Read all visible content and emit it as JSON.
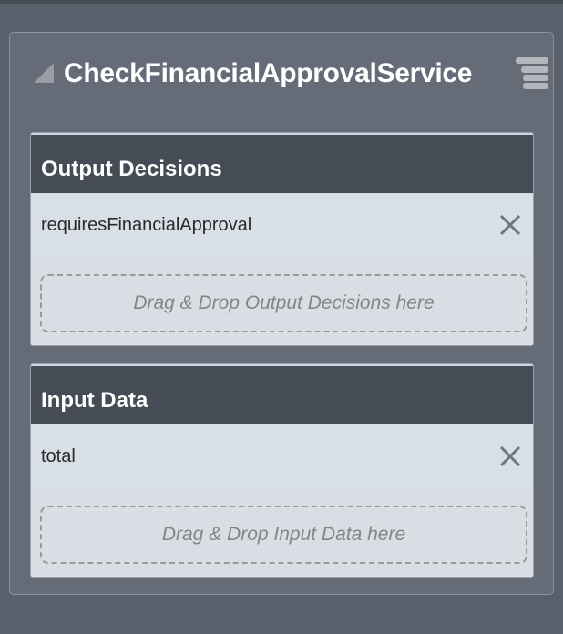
{
  "service": {
    "title": "CheckFinancialApprovalService"
  },
  "sections": [
    {
      "title": "Output Decisions",
      "items": [
        {
          "label": "requiresFinancialApproval"
        }
      ],
      "drop_placeholder": "Drag & Drop Output Decisions here"
    },
    {
      "title": "Input Data",
      "items": [
        {
          "label": "total"
        }
      ],
      "drop_placeholder": "Drag & Drop Input Data here"
    }
  ]
}
